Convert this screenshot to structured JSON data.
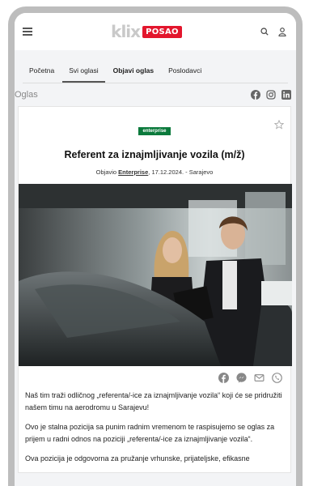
{
  "header": {
    "logo_text": "klix",
    "logo_badge": "POSAO"
  },
  "tabs": [
    {
      "label": "Početna",
      "active": false
    },
    {
      "label": "Svi oglasi",
      "active": true
    },
    {
      "label": "Objavi oglas",
      "active": false
    },
    {
      "label": "Poslodavci",
      "active": false
    }
  ],
  "section": {
    "title": "Oglas"
  },
  "job": {
    "company_logo_text": "enterprise",
    "title": "Referent za iznajmljivanje vozila (m/ž)",
    "meta_prefix": "Objavio ",
    "company": "Enterprise",
    "meta_suffix": ", 17.12.2024. - Sarajevo",
    "paragraphs": [
      "Naš tim traži odličnog „referenta/-ice za iznajmljivanje vozila“ koji će se pridružiti našem timu na aerodromu u Sarajevu!",
      "Ovo je stalna pozicija sa punim radnim vremenom te raspisujemo se oglas za prijem u radni odnos na poziciji „referenta/-ice za iznajmljivanje vozila“.",
      "Ova pozicija je odgovorna za pružanje vrhunske, prijateljske, efikasne"
    ]
  },
  "colors": {
    "brand_red": "#e3162d",
    "enterprise_green": "#0b7a3c"
  }
}
